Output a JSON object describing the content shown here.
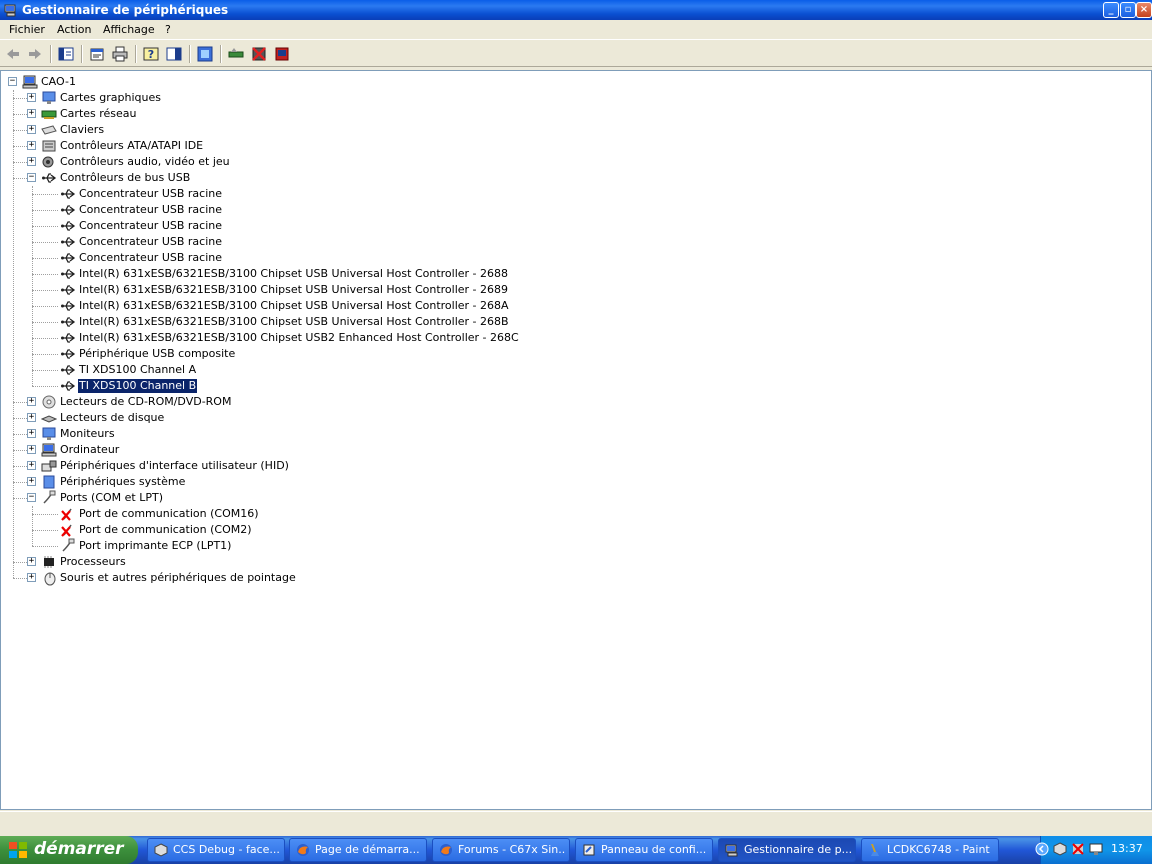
{
  "window": {
    "title": "Gestionnaire de périphériques"
  },
  "menubar": {
    "items": [
      "Fichier",
      "Action",
      "Affichage",
      "?"
    ]
  },
  "toolbar": {
    "icons": [
      "back-arrow-icon",
      "forward-arrow-icon",
      "show-hide-console-tree-icon",
      "properties-icon",
      "print-icon",
      "help-icon",
      "view-icon",
      "scan-hardware-icon",
      "update-driver-icon",
      "disable-device-icon",
      "uninstall-device-icon"
    ]
  },
  "tree": {
    "root": "CAO-1",
    "categories": [
      {
        "label": "Cartes graphiques",
        "icon": "display-adapter-icon",
        "expanded": false
      },
      {
        "label": "Cartes réseau",
        "icon": "network-adapter-icon",
        "expanded": false
      },
      {
        "label": "Claviers",
        "icon": "keyboard-icon",
        "expanded": false
      },
      {
        "label": "Contrôleurs ATA/ATAPI IDE",
        "icon": "ide-controller-icon",
        "expanded": false
      },
      {
        "label": "Contrôleurs audio, vidéo et jeu",
        "icon": "audio-icon",
        "expanded": false
      },
      {
        "label": "Contrôleurs de bus USB",
        "icon": "usb-icon",
        "expanded": true,
        "children": [
          "Concentrateur USB racine",
          "Concentrateur USB racine",
          "Concentrateur USB racine",
          "Concentrateur USB racine",
          "Concentrateur USB racine",
          "Intel(R) 631xESB/6321ESB/3100 Chipset USB Universal Host Controller - 2688",
          "Intel(R) 631xESB/6321ESB/3100 Chipset USB Universal Host Controller - 2689",
          "Intel(R) 631xESB/6321ESB/3100 Chipset USB Universal Host Controller - 268A",
          "Intel(R) 631xESB/6321ESB/3100 Chipset USB Universal Host Controller - 268B",
          "Intel(R) 631xESB/6321ESB/3100 Chipset USB2 Enhanced Host Controller - 268C",
          "Périphérique USB composite",
          "TI XDS100 Channel A",
          "TI XDS100 Channel B"
        ]
      },
      {
        "label": "Lecteurs de CD-ROM/DVD-ROM",
        "icon": "cdrom-icon",
        "expanded": false
      },
      {
        "label": "Lecteurs de disque",
        "icon": "disk-drive-icon",
        "expanded": false
      },
      {
        "label": "Moniteurs",
        "icon": "monitor-icon",
        "expanded": false
      },
      {
        "label": "Ordinateur",
        "icon": "computer-icon",
        "expanded": false
      },
      {
        "label": "Périphériques d'interface utilisateur (HID)",
        "icon": "hid-icon",
        "expanded": false
      },
      {
        "label": "Périphériques système",
        "icon": "system-device-icon",
        "expanded": false
      },
      {
        "label": "Ports (COM et LPT)",
        "icon": "port-icon",
        "expanded": true,
        "children": [
          "Port de communication (COM16)",
          "Port de communication (COM2)",
          "Port imprimante ECP (LPT1)"
        ]
      },
      {
        "label": "Processeurs",
        "icon": "processor-icon",
        "expanded": false
      },
      {
        "label": "Souris et autres périphériques de pointage",
        "icon": "mouse-icon",
        "expanded": false
      }
    ],
    "selected": "TI XDS100 Channel B"
  },
  "taskbar": {
    "start_label": "démarrer",
    "tasks": [
      {
        "label": "CCS Debug - face...",
        "icon": "ccs-icon",
        "active": false
      },
      {
        "label": "Page de démarra...",
        "icon": "firefox-icon",
        "active": false
      },
      {
        "label": "Forums - C67x Sin...",
        "icon": "firefox-icon",
        "active": false
      },
      {
        "label": "Panneau de confi...",
        "icon": "control-panel-icon",
        "active": false
      },
      {
        "label": "Gestionnaire de p...",
        "icon": "device-manager-icon",
        "active": true
      },
      {
        "label": "LCDKC6748 - Paint",
        "icon": "paint-icon",
        "active": false
      }
    ],
    "clock": "13:37"
  },
  "colors": {
    "selection": "#0a246a",
    "titlebar": "#0a5ee8",
    "chrome": "#ece9d8"
  }
}
